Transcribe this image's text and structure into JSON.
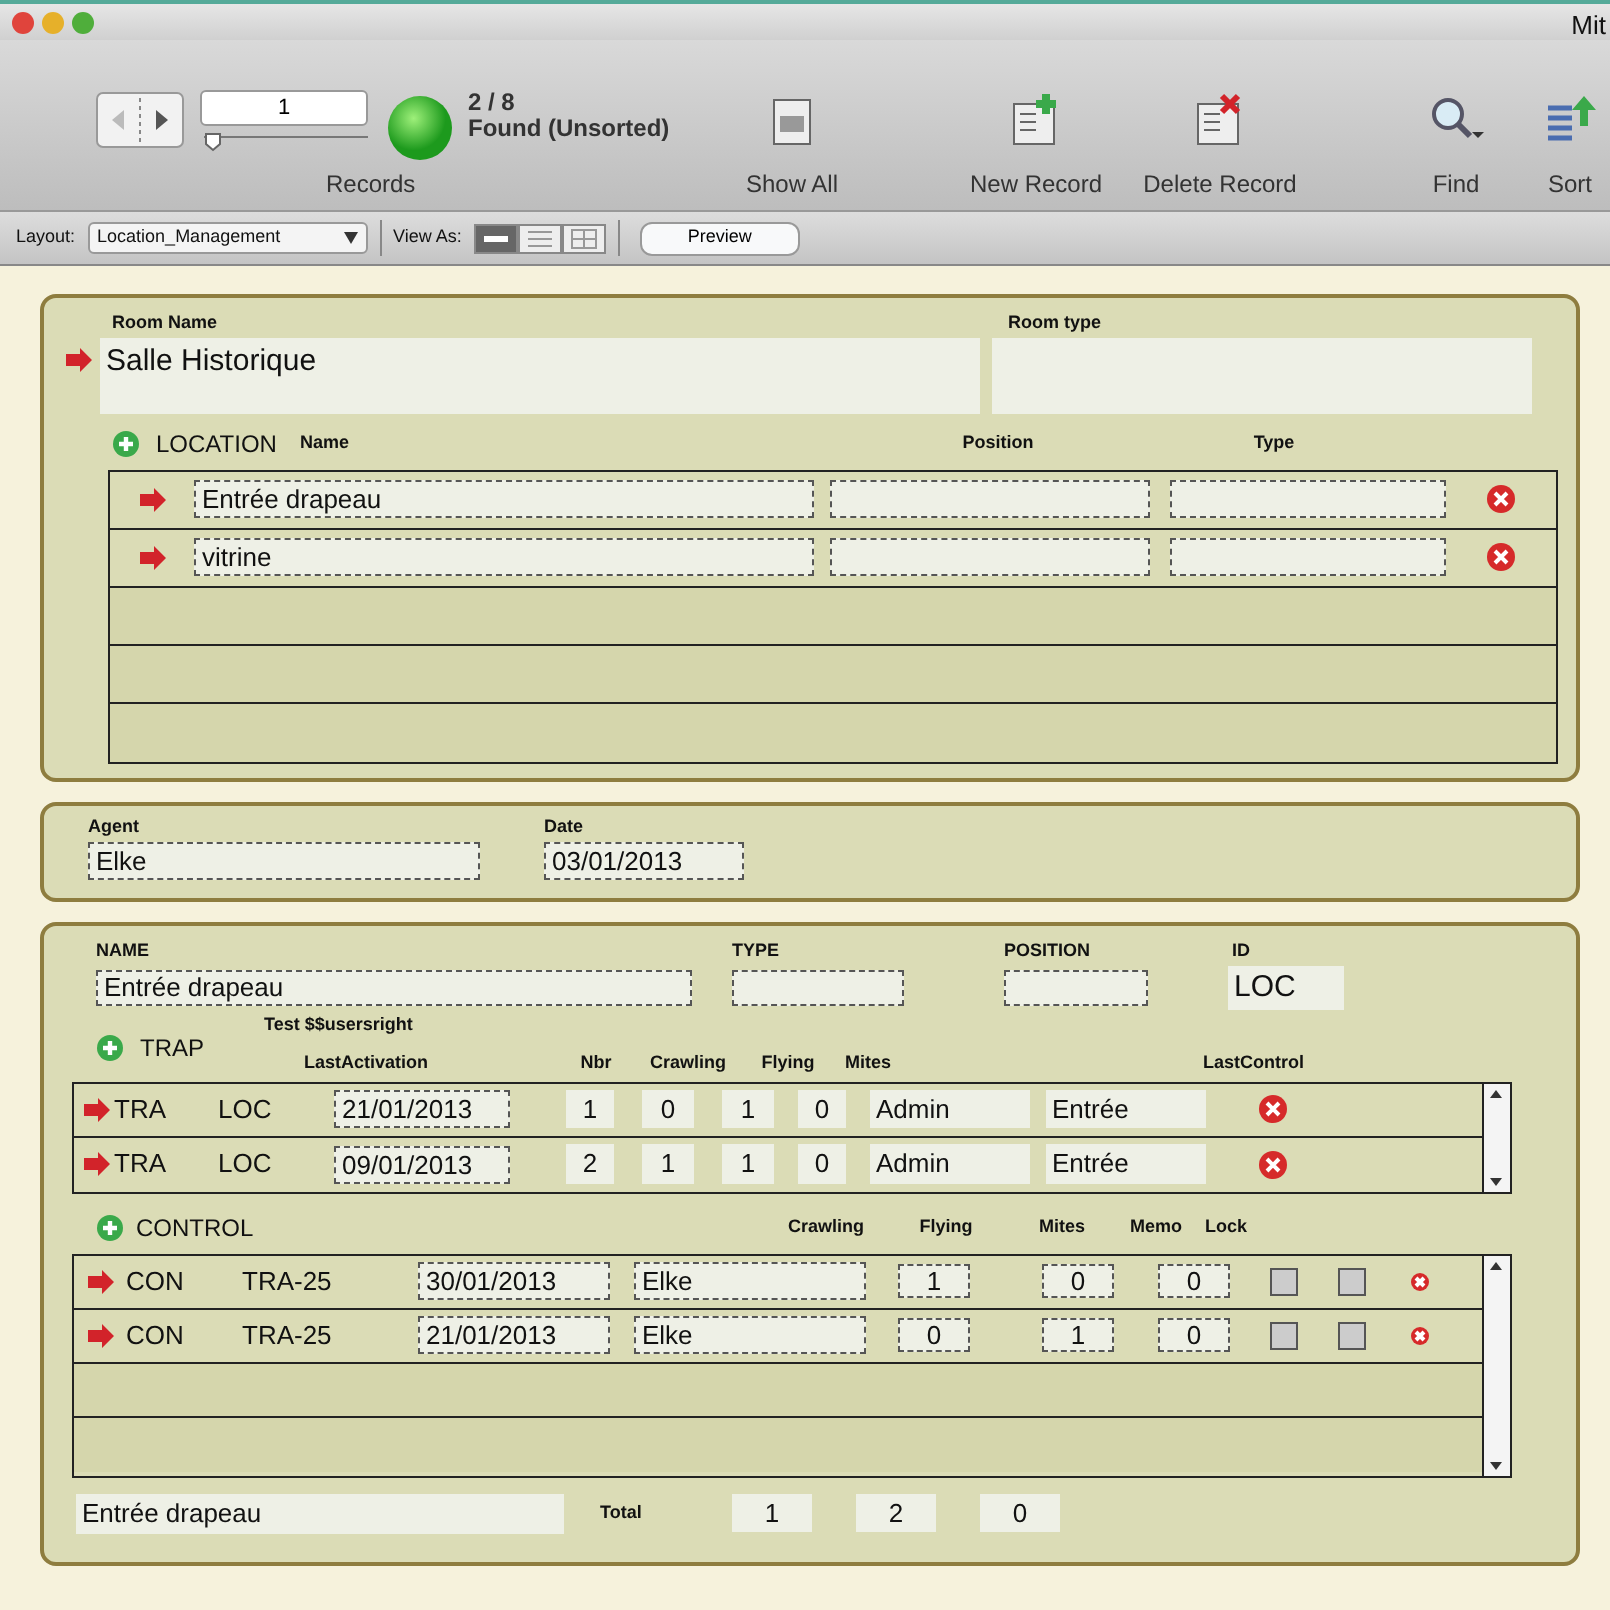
{
  "window": {
    "title": "Mit"
  },
  "toolbar": {
    "record": "1",
    "count": "2 / 8",
    "found": "Found (Unsorted)",
    "records_label": "Records",
    "slider": {
      "level": 0
    },
    "buttons": [
      {
        "kind": "showall",
        "label": "Show All"
      },
      {
        "kind": "new",
        "label": "New Record"
      },
      {
        "kind": "delete",
        "label": "Delete Record"
      },
      {
        "kind": "find",
        "label": "Find"
      },
      {
        "kind": "sort",
        "label": "Sort"
      }
    ]
  },
  "layout_bar": {
    "layout_label": "Layout:",
    "layout": "Location_Management",
    "view_label": "View As:",
    "views": [
      {
        "kind": "form",
        "selected": true
      },
      {
        "kind": "list",
        "selected": false
      },
      {
        "kind": "table",
        "selected": false
      }
    ],
    "preview": "Preview"
  },
  "room": {
    "name_label": "Room Name",
    "name": "Salle Historique",
    "type_label": "Room type",
    "location_label": "LOCATION",
    "columns": [
      "Name",
      "Position",
      "Type"
    ],
    "rows": [
      {
        "name": "Entrée drapeau"
      },
      {
        "name": "vitrine"
      }
    ]
  },
  "agent": {
    "agent_label": "Agent",
    "agent": "Elke",
    "date_label": "Date",
    "date": "03/01/2013"
  },
  "location": {
    "name_label": "NAME",
    "name": "Entrée drapeau",
    "type_label": "TYPE",
    "position_label": "POSITION",
    "id_label": "ID",
    "id": "LOC",
    "trap": {
      "label": "TRAP",
      "note": "Test $$usersright",
      "columns": [
        "LastActivation",
        "Nbr",
        "Crawling",
        "Flying",
        "Mites",
        "LastControl"
      ],
      "rows": [
        {
          "type": "TRA",
          "loc": "LOC",
          "date": "21/01/2013",
          "nbr": "1",
          "crawling": "0",
          "flying": "1",
          "mites": "0",
          "user": "Admin",
          "last_control": "Entrée"
        },
        {
          "type": "TRA",
          "loc": "LOC",
          "date": "09/01/2013",
          "nbr": "2",
          "crawling": "1",
          "flying": "1",
          "mites": "0",
          "user": "Admin",
          "last_control": "Entrée"
        }
      ]
    },
    "control": {
      "label": "CONTROL",
      "columns": [
        "Crawling",
        "Flying",
        "Mites",
        "Memo",
        "Lock"
      ],
      "rows": [
        {
          "type": "CON",
          "trap": "TRA-25",
          "date": "30/01/2013",
          "agent": "Elke",
          "crawling": "1",
          "flying": "0",
          "mites": "0",
          "memo": false,
          "lock": false
        },
        {
          "type": "CON",
          "trap": "TRA-25",
          "date": "21/01/2013",
          "agent": "Elke",
          "crawling": "0",
          "flying": "1",
          "mites": "0",
          "memo": false,
          "lock": false
        }
      ]
    },
    "footer": {
      "name": "Entrée drapeau",
      "total_label": "Total",
      "totals": [
        "1",
        "2",
        "0"
      ]
    }
  }
}
